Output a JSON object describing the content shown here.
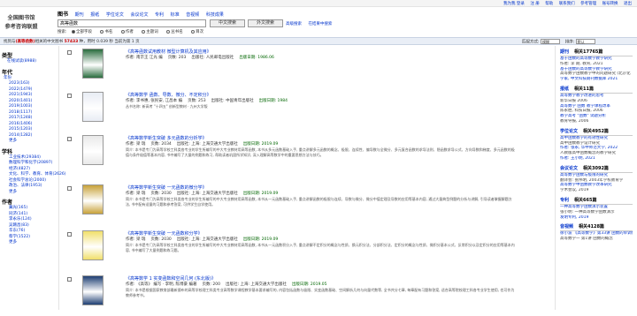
{
  "top_links": [
    "我为我 登录",
    "注 册",
    "帮助",
    "联系我们",
    "参考管理",
    "账号转换",
    "退出"
  ],
  "logo": {
    "line1": "全国图书馆",
    "line2": "参考咨询联盟"
  },
  "nav": [
    {
      "label": "图书",
      "active": true
    },
    {
      "label": "期刊"
    },
    {
      "label": "报纸"
    },
    {
      "label": "学位论文"
    },
    {
      "label": "会议论文"
    },
    {
      "label": "专利"
    },
    {
      "label": "标准"
    },
    {
      "label": "音视频"
    },
    {
      "label": "科技成果"
    }
  ],
  "search": {
    "value": "高等函数",
    "btn_main": "中文搜索",
    "btn_foreign": "外文搜索",
    "adv1": "高级搜索",
    "adv2": "在结果中搜索"
  },
  "scope": {
    "label": "搜索:",
    "options": [
      "全部字段",
      "书名",
      "作者",
      "主题词",
      "丛书名",
      "目次"
    ]
  },
  "info": {
    "prefix": "找到与",
    "keyword": "(高等函数)",
    "middle": "相关的中文图书",
    "count": "57433",
    "tail": "种，用时 0.039 秒",
    "view": "当前为第 1 页",
    "match_label": "匹配方式:",
    "match_val": "模糊",
    "sort_label": "排序:",
    "sort_val": "默认"
  },
  "left": {
    "type_h": "类型",
    "type_items": [
      "在线试读(8988)"
    ],
    "year_h": "年代",
    "year_label": "年份",
    "years": [
      "2023(163)",
      "2022(1479)",
      "2021(1943)",
      "2020(1401)",
      "2019(1003)",
      "2018(1117)",
      "2017(1248)",
      "2016(1406)",
      "2015(1203)",
      "2014(1282)",
      "更多"
    ],
    "subject_h": "学科",
    "subjects": [
      "工业技术(29384)",
      "数理科学和化学(20897)",
      "经济(4827)",
      "文化、科学、教育、体育(2626)",
      "社会科学总论(2000)",
      "政治、法律(1953)",
      "更多"
    ],
    "author_h": "作者",
    "authors": [
      "冀光(165)",
      "同济(141)",
      "李永乐(124)",
      "吴赣昌(83)",
      "华东(76)",
      "蔡学(1522)",
      "更多"
    ]
  },
  "records": [
    {
      "title": "《高等函数试用教材 微型计算机及其应用》",
      "meta1": "作者: 南京王 江光 编",
      "meta2": "页数: 203",
      "meta3": "出版社: 人民邮电出版社",
      "meta4": "出版日期: 1986.06",
      "desc": ""
    },
    {
      "title": "《高等数学 函数、导数、微分、不定积分》",
      "meta1": "作者: 李书惠, 张民安, 江昌本 编",
      "meta2": "页数: 253",
      "meta3": "出版社: 中国青年出版社",
      "meta4": "出版日期: 1984",
      "desc": "丛书名称: 新高考 \"十四五\" 创新型教材 · 九州大学版"
    },
    {
      "title": "《高等数学新生突破 多元函数的分析学》",
      "meta1": "作者: 梁 瑞",
      "meta2": "页数: 2034",
      "meta3": "出版社: 上海: 上海交通大学出版社",
      "meta4": "出版日期: 2019.09",
      "desc": "简介: 本书是专门为高等学校工科类各专业的学生所编写的中大专业教材用高等函数, 本书从多元函数基础入手, 重点讲解多元函数的概念、极限、连续性、偏导数与全微分、多元复合函数的求导法则、隐函数求导公式、方向导数和梯度、多元函数的极值与条件极值等基本内容, 书中编写了大量的例题和练习, 帮助读者巩固所学知识, 深入理解高等数学中的重要思想方法与技巧。"
    },
    {
      "title": "《高等数学新生突破 一元函数的微分学》",
      "meta1": "作者: 梁 瑞",
      "meta2": "页数: 2030",
      "meta3": "出版社: 上海: 上海交通大学出版社",
      "meta4": "出版日期: 2019.09",
      "desc": "简介: 本书是专门为高等学校工科类各专业的学生所编写的中大专业教材用高等函数, 本书从一元函数基础入手, 重点讲解函数的极限与连续、导数与微分、微分中值定理及导数的应用等基本内容, 通过大量典型例题的分析与讲解, 引导读者掌握解题方法, 书中配有适量的习题和参考答案, 可供学生自学使用。"
    },
    {
      "title": "《高等数学新生突破 一元函数积分学》",
      "meta1": "作者: 梁 瑞",
      "meta2": "页数: 2030",
      "meta3": "出版社: 上海: 上海交通大学出版社",
      "meta4": "出版日期: 2019.09",
      "desc": "简介: 本书是专门为高等学校工科类各专业的学生所编写的中大专业教材用高等函数, 本书从一元函数积分入手, 重点讲解不定积分的概念与性质、换元积分法、分部积分法、定积分的概念与性质、微积分基本公式、反常积分以及定积分的应用等基本内容, 书中编写了大量例题和练习题。"
    },
    {
      "title": "《高等数学 1 实变函数和空间几何 (东北版)》",
      "meta1": "作者: 《高等》 编写 · 李明, 陈博豪 编著",
      "meta2": "页数: 200",
      "meta3": "出版社: 上海: 上海交通大学出版社",
      "meta4": "出版日期: 2019.05",
      "desc": "简介: 本书是根据国家教育部最新颁布的高等学校理工科类专业高等数学课程教学基本要求编写的, 内容包括函数与极限、实变函数基础、空间解析几何与向量代数等, 全书共分七章, 每章配有习题和答案, 适合高等院校理工科各专业学生使用, 也可作为教师参考书。"
    }
  ],
  "right": [
    {
      "head": "期刊",
      "cnt": "相关17765篇",
      "lines": [
        "基于函数的高等数学教学研究",
        "作者: 李 期, 教育, 2021",
        "基于函数的高等数学教学研究",
        "高等数学函数教学中的问题研究 (北京化",
        "学家, 中文科技期刊数据库 2021"
      ]
    },
    {
      "head": "报纸",
      "cnt": "相关11篇",
      "lines": [
        "高等数学教学改进的思考",
        "新华日报 2006",
        "高等数学 函数 教学课程改革",
        "陈永胜, 科技日报, 2006",
        "教学高考 \"函数\" 试题分析",
        "教育导报, 2006"
      ]
    },
    {
      "head": "学位论文",
      "cnt": "相关4952篇",
      "lines": [
        "高中函数教学的有效性研究",
        "高中函数教学设计研究",
        "作者: 张永, 华中师范大学, 2022",
        "人教版高中函数概念的教学研究",
        "作者: 王小明, 2021"
      ]
    },
    {
      "head": "会议论文",
      "cnt": "相关3092篇",
      "lines": [
        "高等数学函数与极限的研究",
        "翻译会: 张伟明, 2003年学校教育学",
        "高等数学中函数教学改革研究",
        "学术会议, 2019"
      ]
    },
    {
      "head": "专利",
      "cnt": "相关665篇",
      "lines": [
        "一种高等数学函数演示装置",
        "张小明: 一种高等数学函数演示",
        "发明专利, 2019"
      ]
    },
    {
      "head": "音视频",
      "cnt": "相关4128篇",
      "lines": [
        "徐小波 《高等数学》第33讲 函数的单调性",
        "高等数学一 第1讲 函数的概念"
      ]
    }
  ]
}
